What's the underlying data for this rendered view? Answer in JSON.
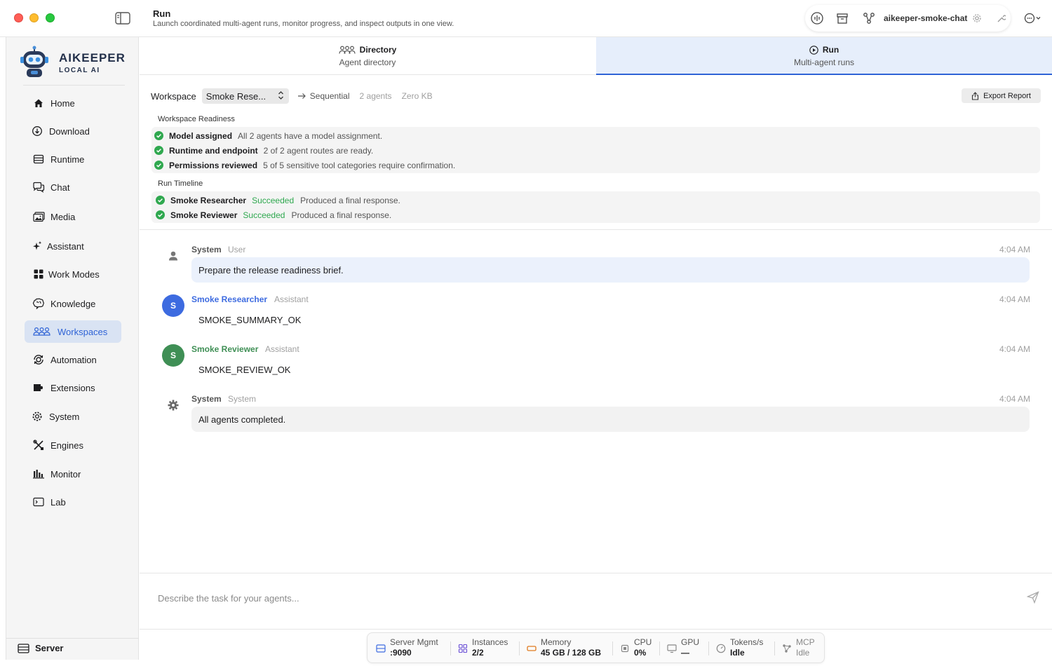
{
  "window": {
    "page_title": "Run",
    "page_subtitle": "Launch coordinated multi-agent runs, monitor progress, and inspect outputs in one view.",
    "toolbar_label": "aikeeper-smoke-chat"
  },
  "brand": {
    "title": "AIKEEPER",
    "subtitle": "LOCAL AI"
  },
  "sidebar": {
    "items": [
      {
        "label": "Home",
        "icon": "home-icon"
      },
      {
        "label": "Download",
        "icon": "download-icon"
      },
      {
        "label": "Runtime",
        "icon": "runtime-icon"
      },
      {
        "label": "Chat",
        "icon": "chat-icon"
      },
      {
        "label": "Media",
        "icon": "media-icon"
      },
      {
        "label": "Assistant",
        "icon": "sparkle-icon"
      },
      {
        "label": "Work Modes",
        "icon": "grid-icon"
      },
      {
        "label": "Knowledge",
        "icon": "brain-icon"
      },
      {
        "label": "Workspaces",
        "icon": "people-icon"
      },
      {
        "label": "Automation",
        "icon": "automation-icon"
      },
      {
        "label": "Extensions",
        "icon": "puzzle-icon"
      },
      {
        "label": "System",
        "icon": "gear-icon"
      },
      {
        "label": "Engines",
        "icon": "tools-icon"
      },
      {
        "label": "Monitor",
        "icon": "bars-icon"
      },
      {
        "label": "Lab",
        "icon": "terminal-icon"
      }
    ],
    "active": "Workspaces",
    "server_label": "Server"
  },
  "tabs": [
    {
      "title": "Directory",
      "subtitle": "Agent directory"
    },
    {
      "title": "Run",
      "subtitle": "Multi-agent runs"
    }
  ],
  "workspace": {
    "label": "Workspace",
    "selected": "Smoke Rese...",
    "mode": "Sequential",
    "agents": "2 agents",
    "size": "Zero KB",
    "export_label": "Export Report"
  },
  "readiness": {
    "title": "Workspace Readiness",
    "items": [
      {
        "key": "Model assigned",
        "value": "All 2 agents have a model assignment."
      },
      {
        "key": "Runtime and endpoint",
        "value": "2 of 2 agent routes are ready."
      },
      {
        "key": "Permissions reviewed",
        "value": "5 of 5 sensitive tool categories require confirmation."
      }
    ]
  },
  "timeline": {
    "title": "Run Timeline",
    "items": [
      {
        "agent": "Smoke Researcher",
        "status": "Succeeded",
        "detail": "Produced a final response."
      },
      {
        "agent": "Smoke Reviewer",
        "status": "Succeeded",
        "detail": "Produced a final response."
      }
    ]
  },
  "messages": [
    {
      "name": "System",
      "role": "User",
      "time": "4:04 AM",
      "text": "Prepare the release readiness brief.",
      "icon": "person-icon"
    },
    {
      "name": "Smoke Researcher",
      "role": "Assistant",
      "time": "4:04 AM",
      "text": "SMOKE_SUMMARY_OK",
      "avatar": "S",
      "color": "#3d6be0"
    },
    {
      "name": "Smoke Reviewer",
      "role": "Assistant",
      "time": "4:04 AM",
      "text": "SMOKE_REVIEW_OK",
      "avatar": "S",
      "color": "#3f8f55"
    },
    {
      "name": "System",
      "role": "System",
      "time": "4:04 AM",
      "text": "All agents completed.",
      "icon": "gear-icon"
    }
  ],
  "composer": {
    "placeholder": "Describe the task for your agents..."
  },
  "status": [
    {
      "label": "Server Mgmt",
      "value": ":9090"
    },
    {
      "label": "Instances",
      "value": "2/2"
    },
    {
      "label": "Memory",
      "value": "45 GB / 128 GB"
    },
    {
      "label": "CPU",
      "value": "0%"
    },
    {
      "label": "GPU",
      "value": "—"
    },
    {
      "label": "Tokens/s",
      "value": "Idle"
    },
    {
      "label": "MCP",
      "value": "Idle"
    }
  ],
  "colors": {
    "accent": "#2f63d6",
    "success": "#2fa84f",
    "active_bg": "#d9e3f3"
  }
}
